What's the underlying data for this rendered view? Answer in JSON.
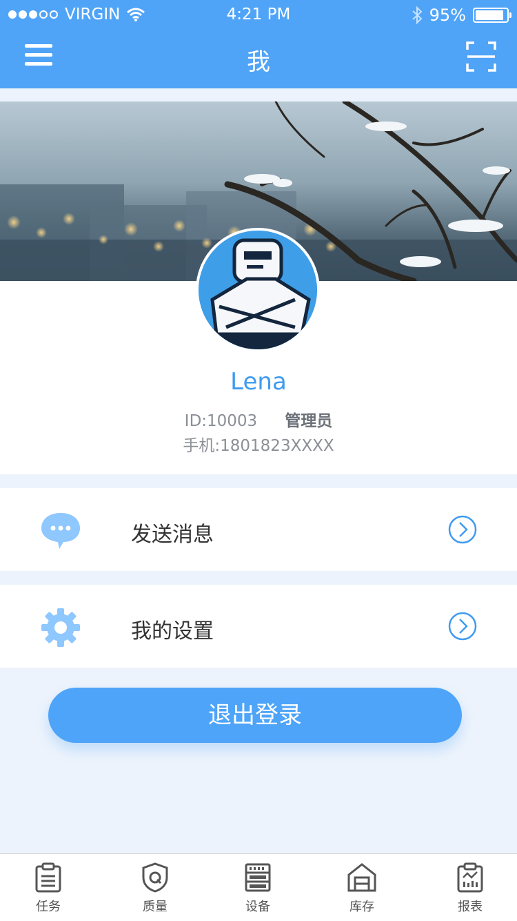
{
  "status_bar": {
    "carrier": "VIRGIN",
    "time": "4:21 PM",
    "battery": "95%",
    "battery_level": 0.95
  },
  "nav": {
    "title": "我"
  },
  "profile": {
    "name": "Lena",
    "id_text": "ID:10003",
    "role": "管理员",
    "phone": "手机:1801823XXXX"
  },
  "menu": [
    {
      "label": "发送消息",
      "icon": "chat-bubble-icon"
    },
    {
      "label": "我的设置",
      "icon": "gear-icon"
    }
  ],
  "logout_label": "退出登录",
  "tabs": [
    {
      "label": "任务",
      "icon": "clipboard-list-icon"
    },
    {
      "label": "质量",
      "icon": "shield-q-icon"
    },
    {
      "label": "设备",
      "icon": "server-rack-icon"
    },
    {
      "label": "库存",
      "icon": "warehouse-icon"
    },
    {
      "label": "报表",
      "icon": "report-chart-icon"
    }
  ],
  "colors": {
    "primary": "#50a4f8",
    "background": "#ecf3fc",
    "name_text": "#3f9bf0",
    "icon_light": "#8fc7ff"
  }
}
